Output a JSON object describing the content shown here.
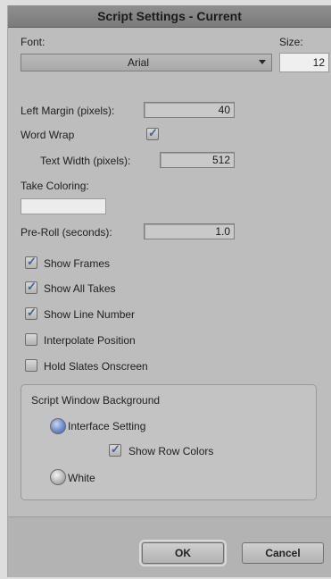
{
  "window": {
    "title": "Script Settings - Current"
  },
  "font": {
    "label": "Font:",
    "value": "Arial"
  },
  "size": {
    "label": "Size:",
    "value": "12"
  },
  "left_margin": {
    "label": "Left Margin (pixels):",
    "value": "40"
  },
  "word_wrap": {
    "label": "Word Wrap",
    "checked": true
  },
  "text_width": {
    "label": "Text Width (pixels):",
    "value": "512"
  },
  "take_coloring": {
    "label": "Take Coloring:",
    "color": "#ececec"
  },
  "pre_roll": {
    "label": "Pre-Roll (seconds):",
    "value": "1.0"
  },
  "checkboxes": [
    {
      "label": "Show Frames",
      "checked": true
    },
    {
      "label": "Show All Takes",
      "checked": true
    },
    {
      "label": "Show Line Number",
      "checked": true
    },
    {
      "label": "Interpolate Position",
      "checked": false
    },
    {
      "label": "Hold Slates Onscreen",
      "checked": false
    }
  ],
  "background_group": {
    "title": "Script Window Background",
    "interface_setting": {
      "label": "Interface Setting",
      "selected": true
    },
    "show_row_colors": {
      "label": "Show Row Colors",
      "checked": true
    },
    "white": {
      "label": "White",
      "selected": false
    }
  },
  "buttons": {
    "ok": "OK",
    "cancel": "Cancel"
  },
  "icons": {
    "check": "✓",
    "dropdown": "chevron-down-icon"
  }
}
